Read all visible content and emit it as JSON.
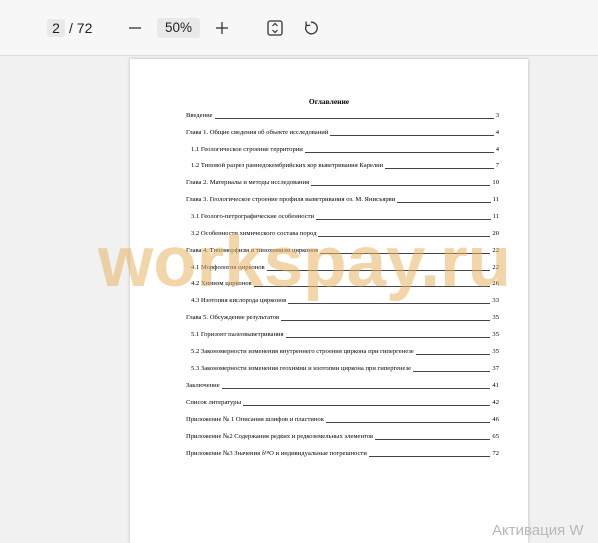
{
  "toolbar": {
    "current_page": "2",
    "total_pages": "/ 72",
    "zoom": "50%",
    "icons": [
      "minus-icon",
      "plus-icon",
      "fit-page-icon",
      "rotate-icon"
    ]
  },
  "document": {
    "toc_title": "Оглавление",
    "entries": [
      {
        "text": "Введение",
        "page": "3",
        "level": 0
      },
      {
        "text": "Глава 1. Общие сведения об объекте исследований",
        "page": "4",
        "level": 0
      },
      {
        "text": "1.1 Геологическое строение территории",
        "page": "4",
        "level": 1
      },
      {
        "text": "1.2 Типовой разрез раннедокембрийских кор выветривания Карелии",
        "page": "7",
        "level": 1
      },
      {
        "text": "Глава 2. Материалы и методы исследования",
        "page": "10",
        "level": 0
      },
      {
        "text": "Глава 3. Геологическое строение профиля выветривания оз. М. Янисъярви",
        "page": "11",
        "level": 0
      },
      {
        "text": "3.1 Геолого-петрографические особенности",
        "page": "11",
        "level": 1
      },
      {
        "text": "3.2 Особенности химического состава пород",
        "page": "20",
        "level": 1
      },
      {
        "text": "Глава 4. Типоморфизм и типохимизм цирконов",
        "page": "22",
        "level": 0
      },
      {
        "text": "4.1 Морфология цирконов",
        "page": "22",
        "level": 1
      },
      {
        "text": "4.2 Химизм цирконов",
        "page": "26",
        "level": 1
      },
      {
        "text": "4.3 Изотопия кислорода цирконов",
        "page": "33",
        "level": 1
      },
      {
        "text": "Глава 5. Обсуждение результатов",
        "page": "35",
        "level": 0
      },
      {
        "text": "5.1 Горизонт палеовыветривания",
        "page": "35",
        "level": 1
      },
      {
        "text": "5.2 Закономерности изменения внутреннего строения циркона при гипергенезе",
        "page": "35",
        "level": 1
      },
      {
        "text": "5.3 Закономерности изменения геохимии и изотопии циркона при гипергенезе",
        "page": "37",
        "level": 1
      },
      {
        "text": "Заключение",
        "page": "41",
        "level": 0
      },
      {
        "text": "Список литературы",
        "page": "42",
        "level": 0
      },
      {
        "text": "Приложение № 1 Описания шлифов и пластинок",
        "page": "46",
        "level": 0
      },
      {
        "text": "Приложение №2 Содержания редких и редкоземельных элементов",
        "page": "65",
        "level": 0
      },
      {
        "text": "Приложение №3 Значения δ¹⁸O и индивидуальные погрешности",
        "page": "72",
        "level": 0
      }
    ]
  },
  "watermark": "workspay.ru",
  "os_overlay": "Активация W"
}
